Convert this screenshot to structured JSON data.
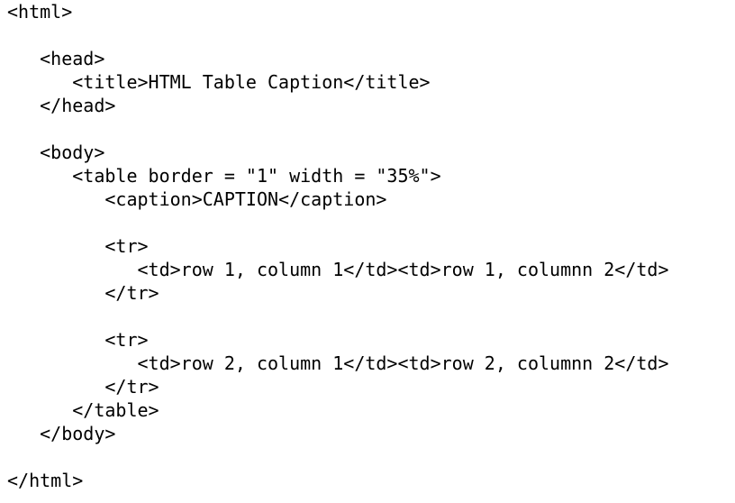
{
  "code": {
    "lines": [
      "<html>",
      "",
      "   <head>",
      "      <title>HTML Table Caption</title>",
      "   </head>",
      "",
      "   <body>",
      "      <table border = \"1\" width = \"35%\">",
      "         <caption>CAPTION</caption>",
      "",
      "         <tr>",
      "            <td>row 1, column 1</td><td>row 1, columnn 2</td>",
      "         </tr>",
      "",
      "         <tr>",
      "            <td>row 2, column 1</td><td>row 2, columnn 2</td>",
      "         </tr>",
      "      </table>",
      "   </body>",
      "",
      "</html>"
    ]
  }
}
